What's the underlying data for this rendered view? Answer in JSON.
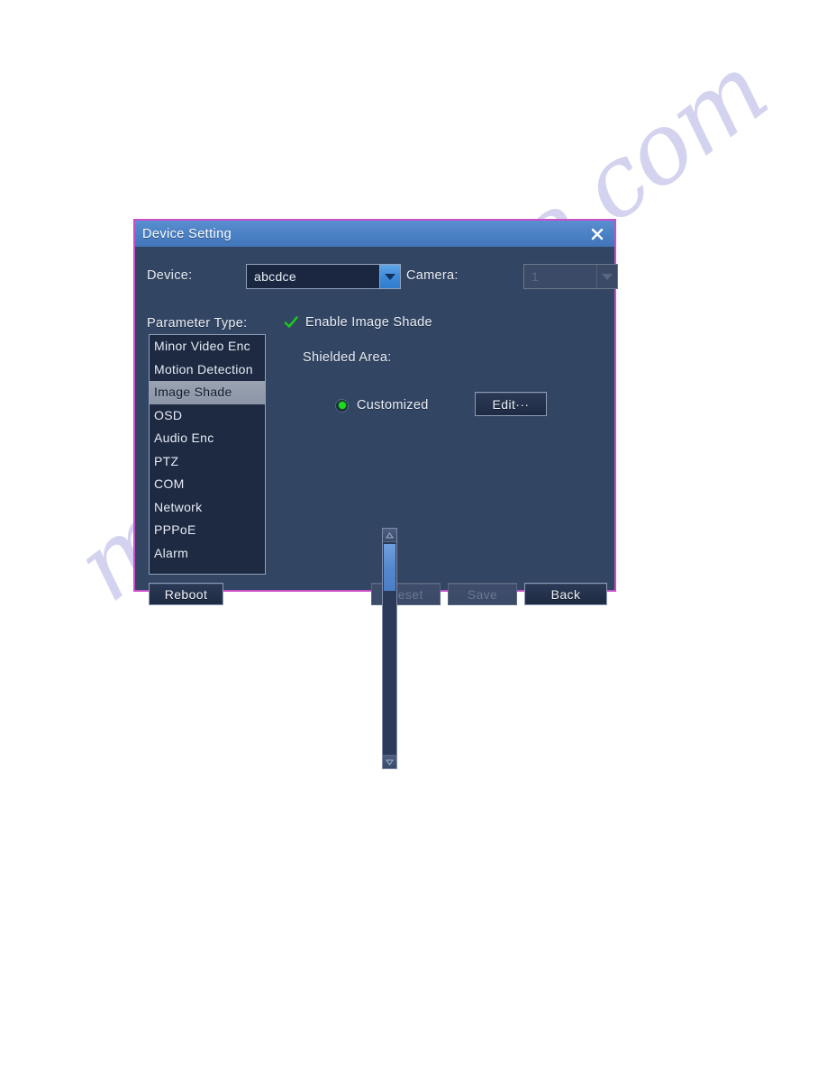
{
  "page": {
    "watermark_text": "manualshive.com"
  },
  "dialog": {
    "title": "Device Setting",
    "close_icon": "close-icon",
    "device": {
      "label": "Device:",
      "value": "abcdce",
      "arrow_icon": "chevron-down-icon"
    },
    "camera": {
      "label": "Camera:",
      "value": "1",
      "arrow_icon": "chevron-down-icon"
    },
    "parameter_type": {
      "label": "Parameter Type:",
      "items": [
        {
          "label": "Minor Video Enc",
          "selected": false
        },
        {
          "label": "Motion Detection",
          "selected": false
        },
        {
          "label": "Image Shade",
          "selected": true
        },
        {
          "label": "OSD",
          "selected": false
        },
        {
          "label": "Audio Enc",
          "selected": false
        },
        {
          "label": "PTZ",
          "selected": false
        },
        {
          "label": "COM",
          "selected": false
        },
        {
          "label": "Network",
          "selected": false
        },
        {
          "label": "PPPoE",
          "selected": false
        },
        {
          "label": "Alarm",
          "selected": false
        }
      ],
      "scrollbar": {
        "up_icon": "caret-up-icon",
        "down_icon": "caret-down-icon",
        "thumb_icon": "scrollbar-thumb"
      }
    },
    "enable_shade": {
      "label": "Enable Image Shade",
      "checked": true,
      "check_icon": "check-icon"
    },
    "shielded_area": {
      "label": "Shielded Area:",
      "option_label": "Customized",
      "option_selected": true,
      "edit_label": "Edit···"
    },
    "footer": {
      "reboot_label": "Reboot",
      "reset_label": "Reset",
      "save_label": "Save",
      "back_label": "Back"
    },
    "colors": {
      "border": "#c84fc8",
      "titlebar": "#4a80c4",
      "body": "#324563",
      "list_bg": "#1e2a42",
      "accent_green": "#1ddb1d",
      "dropdown_button": "#3f8ad8"
    }
  }
}
